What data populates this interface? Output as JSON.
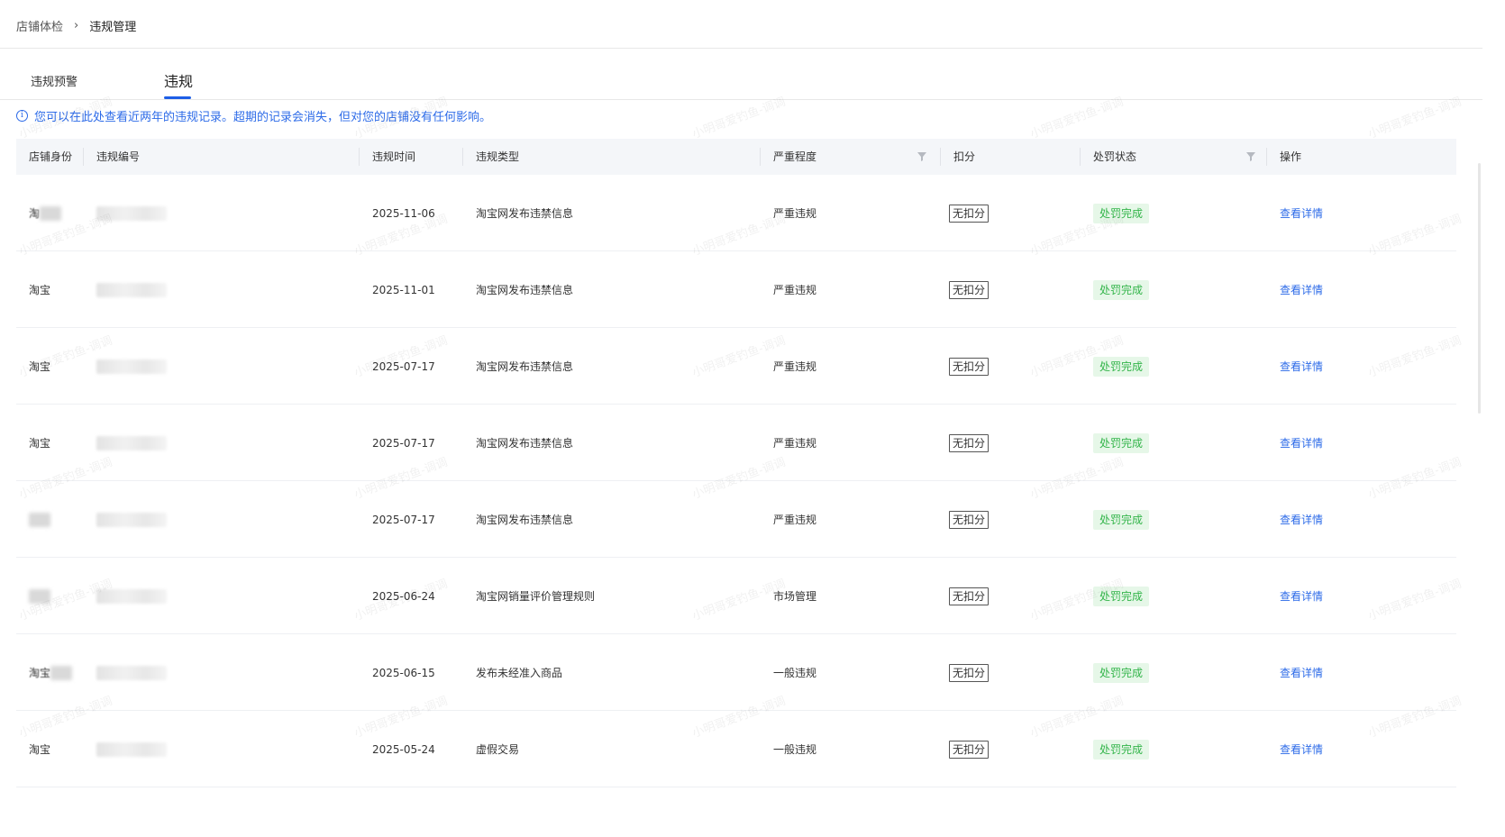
{
  "breadcrumb": {
    "parent": "店铺体检",
    "separator": "›",
    "current": "违规管理"
  },
  "tabs": [
    {
      "label": "违规预警",
      "active": false
    },
    {
      "label": "违规",
      "active": true
    }
  ],
  "notice": {
    "icon": "info-icon",
    "text": "您可以在此处查看近两年的违规记录。超期的记录会消失，但对您的店铺没有任何影响。"
  },
  "table": {
    "columns": [
      {
        "label": "店铺身份"
      },
      {
        "label": "违规编号"
      },
      {
        "label": "违规时间"
      },
      {
        "label": "违规类型"
      },
      {
        "label": "严重程度",
        "filter_icon": "filter-icon"
      },
      {
        "label": "扣分"
      },
      {
        "label": "处罚状态",
        "filter_icon": "filter-icon"
      },
      {
        "label": "操作"
      }
    ],
    "rows": [
      {
        "store": "淘",
        "store_blurred": true,
        "time": "2025-11-06",
        "type": "淘宝网发布违禁信息",
        "severity": "严重违规",
        "deduct": "无扣分",
        "status": "处罚完成",
        "action": "查看详情"
      },
      {
        "store": "淘宝",
        "store_blurred": false,
        "time": "2025-11-01",
        "type": "淘宝网发布违禁信息",
        "severity": "严重违规",
        "deduct": "无扣分",
        "status": "处罚完成",
        "action": "查看详情"
      },
      {
        "store": "淘宝",
        "store_blurred": false,
        "time": "2025-07-17",
        "type": "淘宝网发布违禁信息",
        "severity": "严重违规",
        "deduct": "无扣分",
        "status": "处罚完成",
        "action": "查看详情"
      },
      {
        "store": "淘宝",
        "store_blurred": false,
        "time": "2025-07-17",
        "type": "淘宝网发布违禁信息",
        "severity": "严重违规",
        "deduct": "无扣分",
        "status": "处罚完成",
        "action": "查看详情"
      },
      {
        "store": "",
        "store_blurred": true,
        "time": "2025-07-17",
        "type": "淘宝网发布违禁信息",
        "severity": "严重违规",
        "deduct": "无扣分",
        "status": "处罚完成",
        "action": "查看详情"
      },
      {
        "store": "",
        "store_blurred": true,
        "time": "2025-06-24",
        "type": "淘宝网销量评价管理规则",
        "severity": "市场管理",
        "deduct": "无扣分",
        "status": "处罚完成",
        "action": "查看详情"
      },
      {
        "store": "淘宝",
        "store_blurred": true,
        "time": "2025-06-15",
        "type": "发布未经准入商品",
        "severity": "一般违规",
        "deduct": "无扣分",
        "status": "处罚完成",
        "action": "查看详情"
      },
      {
        "store": "淘宝",
        "store_blurred": false,
        "time": "2025-05-24",
        "type": "虚假交易",
        "severity": "一般违规",
        "deduct": "无扣分",
        "status": "处罚完成",
        "action": "查看详情"
      }
    ]
  },
  "watermark": {
    "text": "小明哥爱钓鱼-调调"
  },
  "colors": {
    "link": "#2d6be8",
    "tab_ink": "#1d5ee6",
    "status_bg": "#e6f7e8",
    "status_text": "#33b54a",
    "header_bg": "#f4f6f9"
  }
}
